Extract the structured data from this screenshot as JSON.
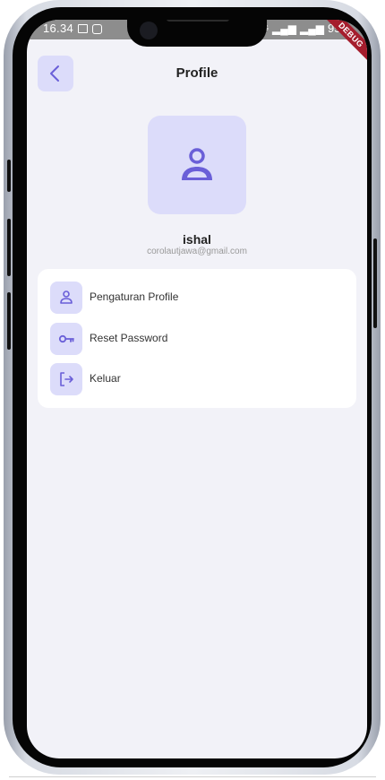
{
  "status_bar": {
    "time": "16.34",
    "battery": "95%",
    "icons": [
      "gallery-icon",
      "instagram-icon",
      "mute-icon",
      "4g-icon",
      "signal-icon",
      "signal-icon"
    ]
  },
  "debug_banner": "DEBUG",
  "header": {
    "title": "Profile",
    "back_icon": "chevron-left-icon"
  },
  "profile": {
    "avatar_icon": "user-icon",
    "name": "ishal",
    "email": "corolautjawa@gmail.com"
  },
  "menu": {
    "items": [
      {
        "label": "Pengaturan Profile",
        "icon": "user-icon"
      },
      {
        "label": "Reset Password",
        "icon": "key-icon"
      },
      {
        "label": "Keluar",
        "icon": "logout-icon"
      }
    ]
  },
  "colors": {
    "accent": "#6a5fd8",
    "accent_light": "#dcdcfa",
    "background": "#f2f2f8",
    "card": "#ffffff"
  }
}
